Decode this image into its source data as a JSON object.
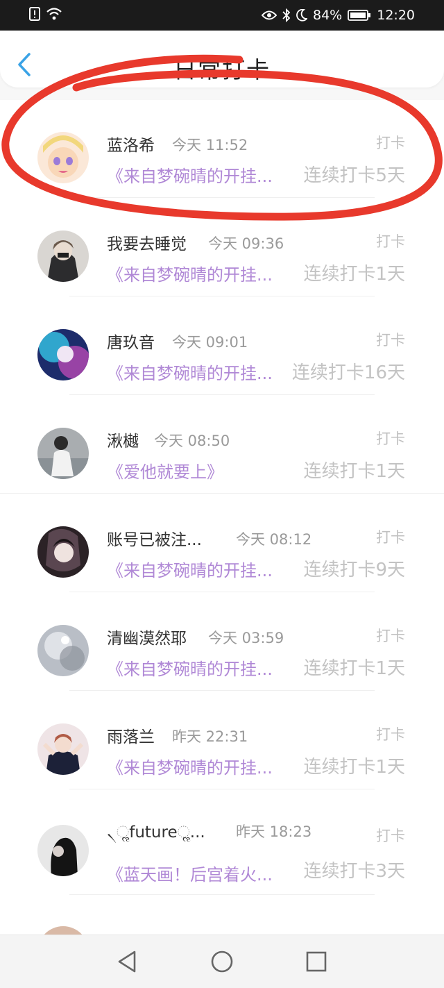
{
  "status_bar": {
    "battery": "84%",
    "time": "12:20",
    "icons": [
      "alert-icon",
      "wifi-icon",
      "eye-icon",
      "bluetooth-icon",
      "moon-icon",
      "battery-icon"
    ]
  },
  "header": {
    "title": "日常打卡",
    "back_icon": "chevron-left-icon"
  },
  "list": [
    {
      "name": "蓝洛希",
      "time": "今天 11:52",
      "action": "打卡",
      "snippet": "《来自梦碗晴的开挂...",
      "streak": "连续打卡5天"
    },
    {
      "name": "我要去睡觉",
      "time": "今天 09:36",
      "action": "打卡",
      "snippet": "《来自梦碗晴的开挂...",
      "streak": "连续打卡1天"
    },
    {
      "name": "唐玖音",
      "time": "今天 09:01",
      "action": "打卡",
      "snippet": "《来自梦碗晴的开挂...",
      "streak": "连续打卡16天"
    },
    {
      "name": "湫樾",
      "time": "今天 08:50",
      "action": "打卡",
      "snippet": "《爱他就要上》",
      "streak": "连续打卡1天"
    },
    {
      "name": "账号已被注...",
      "time": "今天 08:12",
      "action": "打卡",
      "snippet": "《来自梦碗晴的开挂...",
      "streak": "连续打卡9天"
    },
    {
      "name": "清幽漠然耶",
      "time": "今天 03:59",
      "action": "打卡",
      "snippet": "《来自梦碗晴的开挂...",
      "streak": "连续打卡1天"
    },
    {
      "name": "雨落兰",
      "time": "昨天 22:31",
      "action": "打卡",
      "snippet": "《来自梦碗晴的开挂...",
      "streak": "连续打卡1天"
    },
    {
      "name": "৲ૢfutureૢ...",
      "time": "昨天 18:23",
      "action": "打卡",
      "snippet": "《蓝天画！后宫着火...",
      "streak": "连续打卡3天"
    }
  ],
  "colors": {
    "accent": "#3aa3e6",
    "snippet": "#b088d6",
    "annotation": "#e8392c"
  },
  "nav": {
    "icons": [
      "back-triangle-icon",
      "home-circle-icon",
      "recents-square-icon"
    ]
  }
}
